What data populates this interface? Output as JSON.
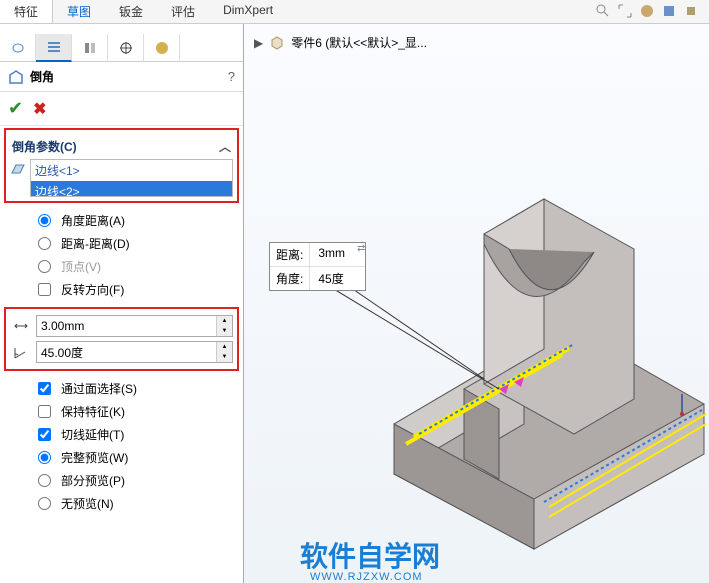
{
  "tabs": {
    "t0": "特征",
    "t1": "草图",
    "t2": "钣金",
    "t3": "评估",
    "t4": "DimXpert"
  },
  "docbar": {
    "title": "零件6  (默认<<默认>_显..."
  },
  "feature": {
    "title": "倒角",
    "help": "?"
  },
  "section": {
    "chamfer_params": "倒角参数(C)"
  },
  "selections": {
    "item1": "边线<1>",
    "item2": "边线<2>"
  },
  "options": {
    "angle_dist": "角度距离(A)",
    "dist_dist": "距离-距离(D)",
    "vertex": "顶点(V)",
    "reverse": "反转方向(F)",
    "thru_face": "通过面选择(S)",
    "keep_feat": "保持特征(K)",
    "tangent": "切线延伸(T)",
    "full_prev": "完整预览(W)",
    "partial_prev": "部分预览(P)",
    "no_prev": "无预览(N)"
  },
  "params": {
    "distance": "3.00mm",
    "angle": "45.00度"
  },
  "annotation": {
    "dist_label": "距离:",
    "dist_val": "3mm",
    "angle_label": "角度:",
    "angle_val": "45度"
  },
  "watermark": {
    "main": "软件自学网",
    "sub": "WWW.RJZXW.COM"
  }
}
